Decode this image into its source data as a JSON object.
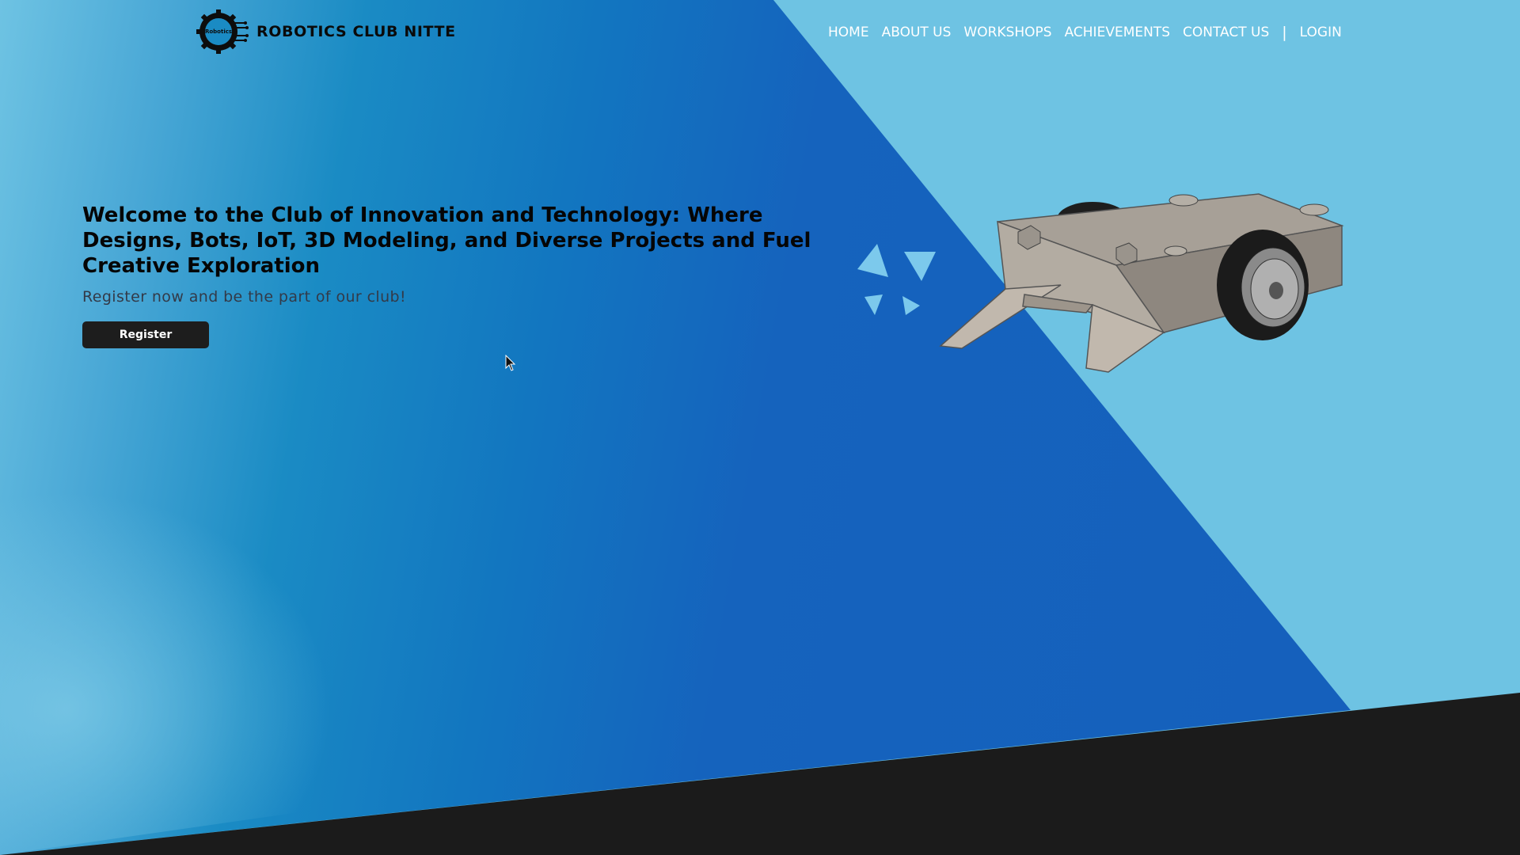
{
  "header": {
    "brand_name": "ROBOTICS CLUB NITTE",
    "logo_text": "Robotics",
    "nav": [
      {
        "label": "HOME"
      },
      {
        "label": "ABOUT US"
      },
      {
        "label": "WORKSHOPS"
      },
      {
        "label": "ACHIEVEMENTS"
      },
      {
        "label": "CONTACT US"
      },
      {
        "label": "LOGIN"
      }
    ],
    "separator": "|"
  },
  "hero": {
    "title": "Welcome to the Club of Innovation and Technology: Where Designs, Bots, IoT, 3D Modeling, and Diverse Projects and Fuel Creative Exploration",
    "subtitle": "Register now and be the part of our club!",
    "register_label": "Register"
  },
  "colors": {
    "primary_blue": "#155fbc",
    "light_blue": "#6ec3e3",
    "dark_footer": "#1b1b1b",
    "button_bg": "#1d1d1d"
  },
  "icons": {
    "logo": "gear-logo-icon",
    "robot": "robot-chassis-3d-model",
    "decoration": "triangle-sparkle-icon",
    "cursor": "mouse-pointer-icon"
  }
}
